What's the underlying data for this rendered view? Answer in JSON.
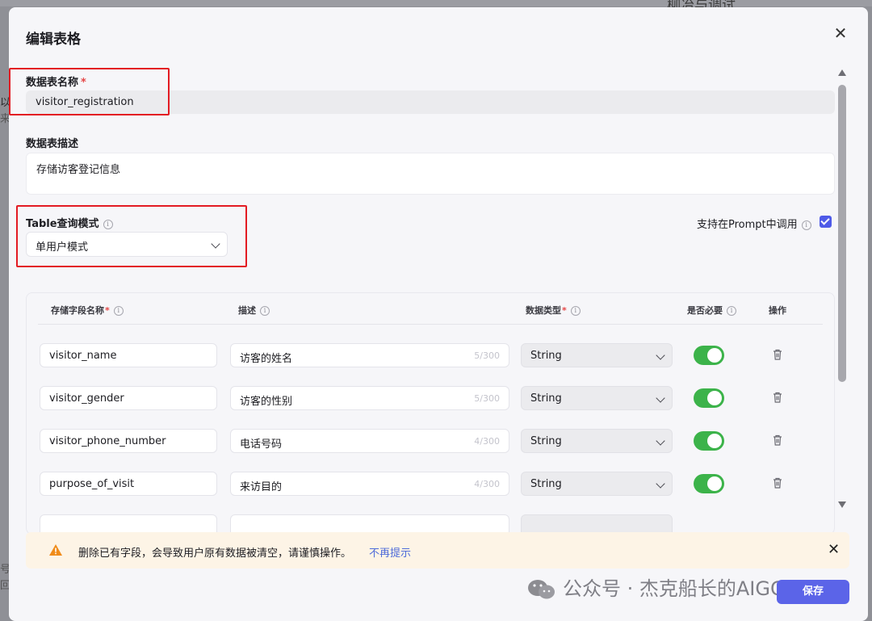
{
  "backdrop": {
    "top_right": "柳冶与调试",
    "left_chars": [
      "以",
      "来",
      "号",
      "回"
    ]
  },
  "modal": {
    "title": "编辑表格",
    "close_icon": "close-icon"
  },
  "table_name": {
    "label": "数据表名称",
    "required_mark": "*",
    "value": "visitor_registration"
  },
  "table_desc": {
    "label": "数据表描述",
    "value": "存储访客登记信息"
  },
  "query_mode": {
    "label": "Table查询模式",
    "selected": "单用户模式"
  },
  "prompt_support": {
    "label": "支持在Prompt中调用",
    "checked": true
  },
  "fields_table": {
    "headers": {
      "name": "存储字段名称",
      "name_req": "*",
      "desc": "描述",
      "type": "数据类型",
      "type_req": "*",
      "required": "是否必要",
      "actions": "操作"
    },
    "rows": [
      {
        "name": "visitor_name",
        "desc": "访客的姓名",
        "count": "5/300",
        "type": "String",
        "required": true
      },
      {
        "name": "visitor_gender",
        "desc": "访客的性别",
        "count": "5/300",
        "type": "String",
        "required": true
      },
      {
        "name": "visitor_phone_number",
        "desc": "电话号码",
        "count": "4/300",
        "type": "String",
        "required": true
      },
      {
        "name": "purpose_of_visit",
        "desc": "来访目的",
        "count": "4/300",
        "type": "String",
        "required": true
      }
    ]
  },
  "warning": {
    "text": "删除已有字段，会导致用户原有数据被清空，请谨慎操作。",
    "link": "不再提示"
  },
  "watermark": "公众号 · 杰克船长的AIGC",
  "save_button": "保存",
  "colors": {
    "accent": "#5b64e8",
    "toggle_on": "#3cb34a",
    "highlight_box": "#e31b23",
    "warning_bg": "#fdf4e6"
  }
}
